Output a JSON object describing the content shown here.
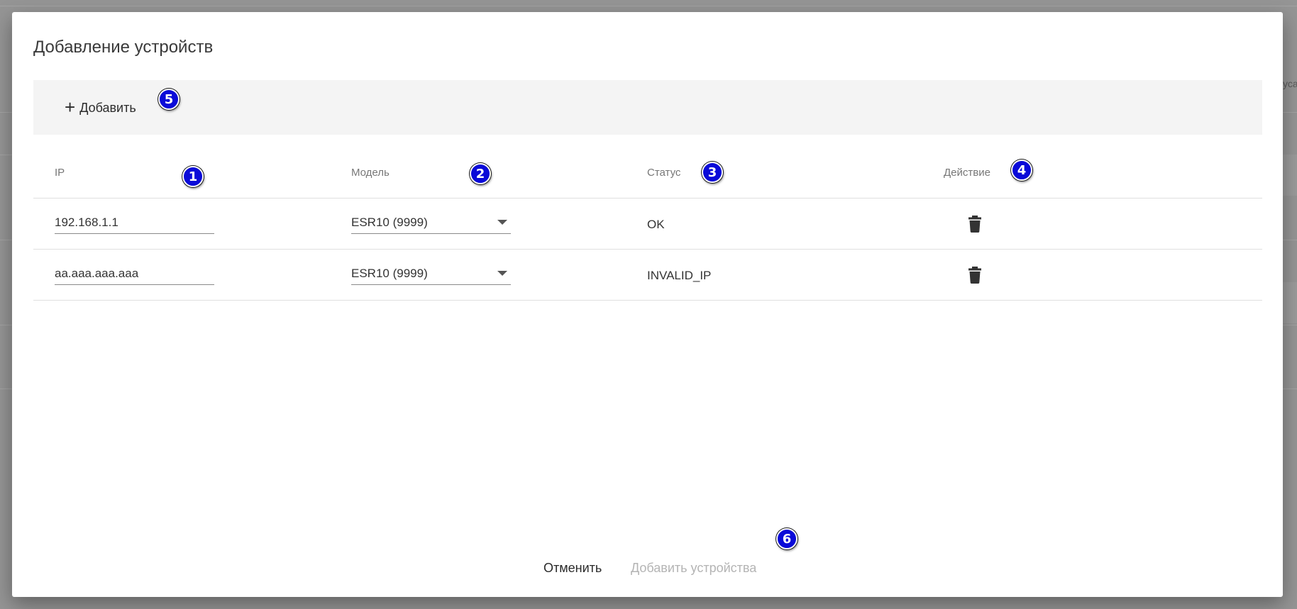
{
  "background": {
    "right_edge_text": "уса"
  },
  "dialog": {
    "title": "Добавление устройств",
    "toolbar": {
      "add_label": "Добавить",
      "add_icon": "plus-icon"
    },
    "table": {
      "headers": {
        "ip": "IP",
        "model": "Модель",
        "status": "Статус",
        "action": "Действие"
      },
      "rows": [
        {
          "ip": "192.168.1.1",
          "model": "ESR10 (9999)",
          "status": "OK",
          "action_icon": "trash-icon"
        },
        {
          "ip": "aa.aaa.aaa.aaa",
          "model": "ESR10 (9999)",
          "status": "INVALID_IP",
          "action_icon": "trash-icon"
        }
      ]
    },
    "footer": {
      "cancel_label": "Отменить",
      "submit_label": "Добавить устройства"
    }
  },
  "markers": [
    "1",
    "2",
    "3",
    "4",
    "5",
    "6"
  ],
  "colors": {
    "marker": "#0a0ad8",
    "toolbar_bg": "#f4f4f4",
    "disabled_text": "#b4b4b4",
    "overlay": "#959595"
  }
}
